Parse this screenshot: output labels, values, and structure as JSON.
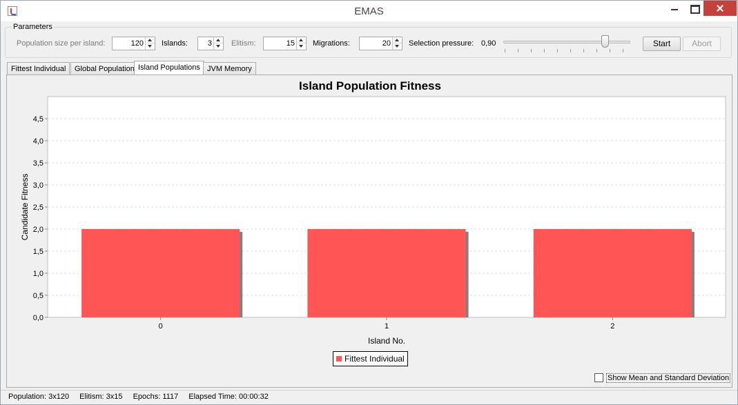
{
  "window": {
    "title": "EMAS"
  },
  "parameters": {
    "legend": "Parameters",
    "population_label": "Population size per island:",
    "population_value": "120",
    "islands_label": "Islands:",
    "islands_value": "3",
    "elitism_label": "Elitism:",
    "elitism_value": "15",
    "migrations_label": "Migrations:",
    "migrations_value": "20",
    "selection_label": "Selection pressure:",
    "selection_value": "0,90",
    "start_label": "Start",
    "abort_label": "Abort"
  },
  "tabs": [
    {
      "label": "Fittest Individual",
      "active": false
    },
    {
      "label": "Global Population",
      "active": false
    },
    {
      "label": "Island Populations",
      "active": true
    },
    {
      "label": "JVM Memory",
      "active": false
    }
  ],
  "chart_data": {
    "type": "bar",
    "title": "Island Population Fitness",
    "xlabel": "Island No.",
    "ylabel": "Candidate Fitness",
    "categories": [
      "0",
      "1",
      "2"
    ],
    "series": [
      {
        "name": "Fittest Individual",
        "values": [
          2.0,
          2.0,
          2.0
        ],
        "color": "#ff5555"
      }
    ],
    "ylim": [
      0,
      5
    ],
    "yticks": [
      "0,0",
      "0,5",
      "1,0",
      "1,5",
      "2,0",
      "2,5",
      "3,0",
      "3,5",
      "4,0",
      "4,5"
    ],
    "grid": true,
    "legend_position": "bottom"
  },
  "controls": {
    "show_mean_label": "Show Mean and Standard Deviation",
    "show_mean_checked": false
  },
  "status": {
    "population": "Population: 3x120",
    "elitism": "Elitism: 3x15",
    "epochs": "Epochs: 1117",
    "elapsed": "Elapsed Time: 00:00:32"
  }
}
